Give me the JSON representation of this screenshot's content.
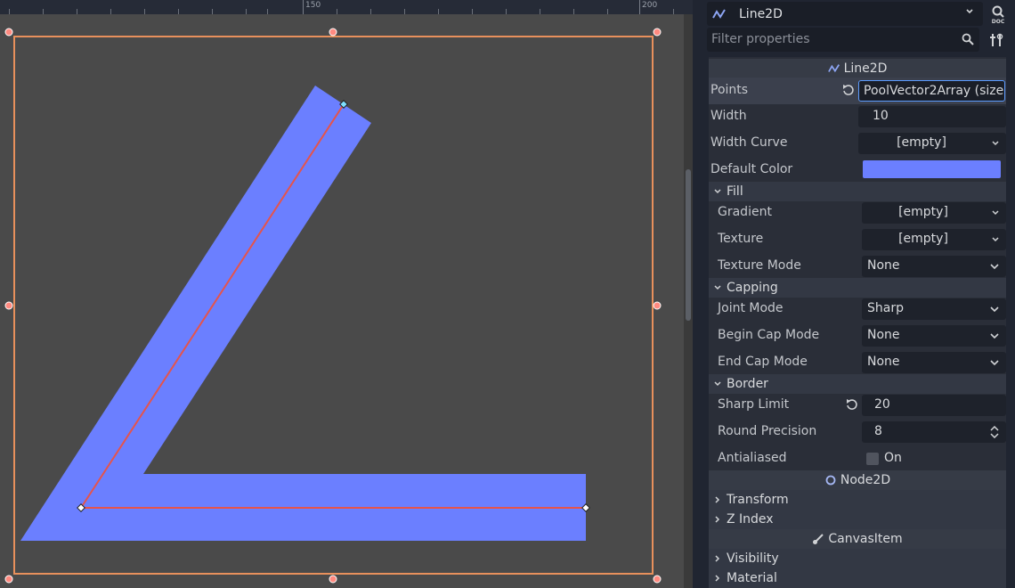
{
  "ruler": {
    "labels": [
      "150",
      "200"
    ]
  },
  "header": {
    "node_type": "Line2D",
    "filter_placeholder": "Filter properties"
  },
  "icons": {
    "node": "line2d-icon",
    "doc": "doc-icon",
    "search": "search-icon",
    "tools": "tools-icon",
    "revert": "revert-icon",
    "dropdown": "chevron-down-icon",
    "stepper": "stepper-icon"
  },
  "colors": {
    "line_fill": "#6b7fff",
    "line_center": "#e5544b",
    "selection": "#e8905c"
  },
  "sections": {
    "line2d": "Line2D",
    "node2d": "Node2D",
    "canvas_item": "CanvasItem"
  },
  "props": {
    "points": {
      "label": "Points",
      "value": "PoolVector2Array (size"
    },
    "width": {
      "label": "Width",
      "value": "10"
    },
    "width_curve": {
      "label": "Width Curve",
      "value": "[empty]"
    },
    "default_color": {
      "label": "Default Color",
      "value": "#6b7fff"
    }
  },
  "groups": {
    "fill": {
      "label": "Fill",
      "gradient": {
        "label": "Gradient",
        "value": "[empty]"
      },
      "texture": {
        "label": "Texture",
        "value": "[empty]"
      },
      "texture_mode": {
        "label": "Texture Mode",
        "value": "None"
      }
    },
    "capping": {
      "label": "Capping",
      "joint_mode": {
        "label": "Joint Mode",
        "value": "Sharp"
      },
      "begin_cap": {
        "label": "Begin Cap Mode",
        "value": "None"
      },
      "end_cap": {
        "label": "End Cap Mode",
        "value": "None"
      }
    },
    "border": {
      "label": "Border",
      "sharp_limit": {
        "label": "Sharp Limit",
        "value": "20"
      },
      "round_precision": {
        "label": "Round Precision",
        "value": "8"
      },
      "antialiased": {
        "label": "Antialiased",
        "value": "On",
        "checked": false
      }
    }
  },
  "node2d_groups": {
    "transform": "Transform",
    "z_index": "Z Index"
  },
  "canvas_groups": {
    "visibility": "Visibility",
    "material": "Material"
  }
}
